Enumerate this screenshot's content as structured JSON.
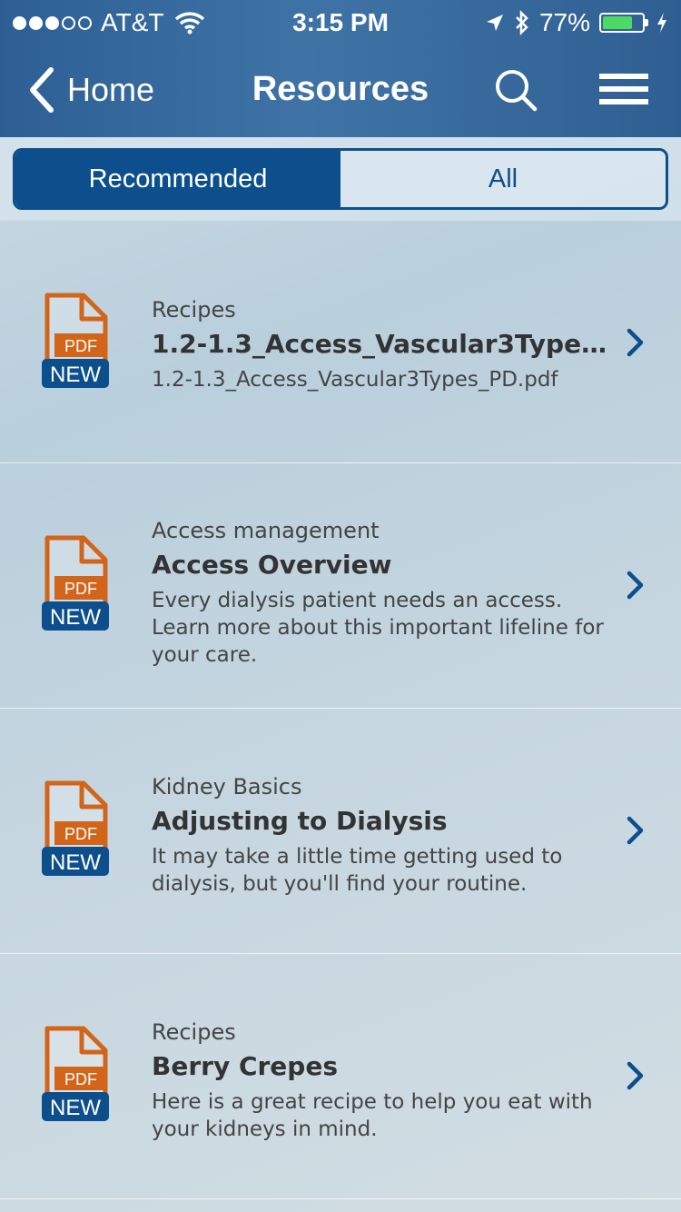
{
  "status_bar": {
    "carrier": "AT&T",
    "time": "3:15 PM",
    "battery": "77%",
    "battery_level": 0.77,
    "signal_bars_filled": 3,
    "signal_bars_total": 5
  },
  "nav": {
    "back_label": "Home",
    "title": "Resources"
  },
  "tabs": [
    {
      "label": "Recommended",
      "active": true
    },
    {
      "label": "All",
      "active": false
    }
  ],
  "icon_labels": {
    "pdf": "PDF",
    "new": "NEW"
  },
  "colors": {
    "accent": "#0c4f8c",
    "pdf_orange": "#d3651b",
    "header": "#3a6ea4"
  },
  "resources": [
    {
      "category": "Recipes",
      "title": "1.2-1.3_Access_Vascular3Types_PD.pdf",
      "description": "1.2-1.3_Access_Vascular3Types_PD.pdf",
      "icon": "pdf-new-icon"
    },
    {
      "category": "Access management",
      "title": "Access Overview",
      "description": "Every dialysis patient needs an access. Learn more about this important lifeline for your care.",
      "icon": "pdf-new-icon"
    },
    {
      "category": "Kidney Basics",
      "title": "Adjusting to Dialysis",
      "description": "It may take a little time getting used to dialysis, but you'll find your routine.",
      "icon": "pdf-new-icon"
    },
    {
      "category": "Recipes",
      "title": "Berry Crepes",
      "description": "Here is a great recipe to help you eat with your kidneys in mind.",
      "icon": "pdf-new-icon"
    }
  ]
}
